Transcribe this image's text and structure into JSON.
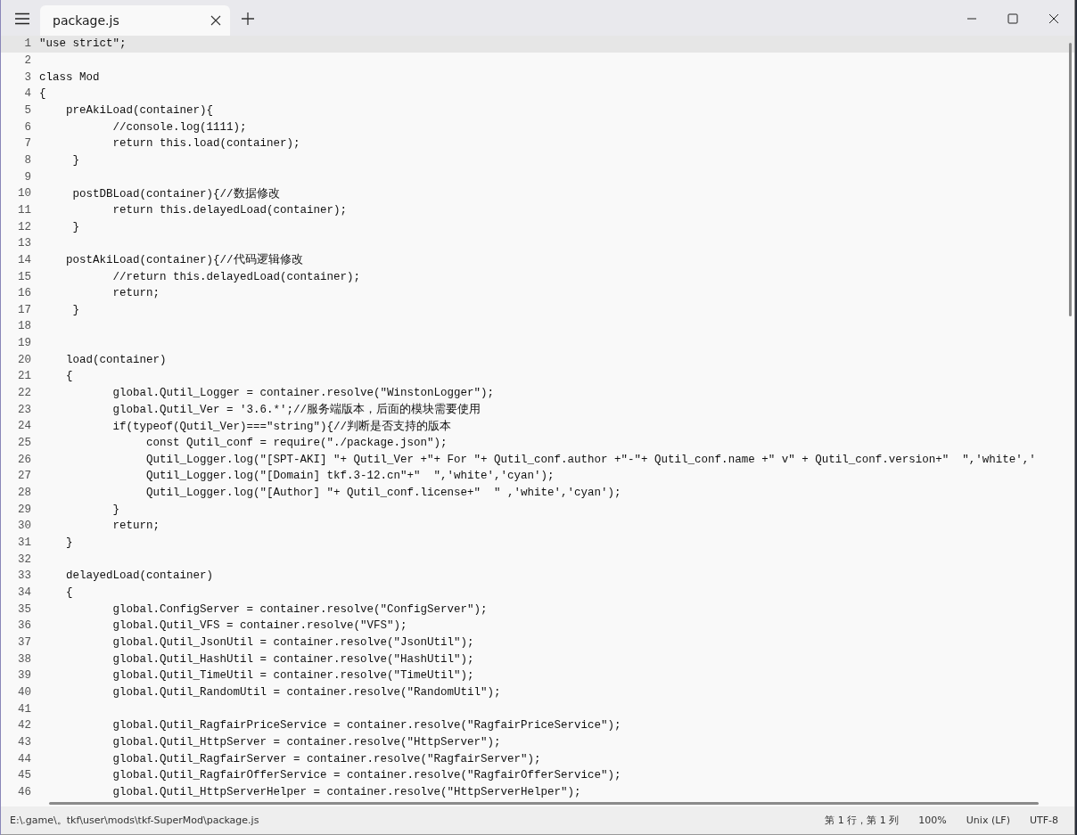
{
  "tabs": [
    {
      "title": "package.js",
      "selected": true
    }
  ],
  "lines": [
    {
      "number": "1",
      "text": "\"use strict\";",
      "current": true
    },
    {
      "number": "2",
      "current": false
    },
    {
      "number": "3",
      "text": "class Mod",
      "current": false
    },
    {
      "number": "4",
      "text": "{",
      "current": false
    },
    {
      "number": "5",
      "text": "    preAkiLoad(container){",
      "current": false
    },
    {
      "number": "6",
      "text": "           //console.log(1111);",
      "current": false
    },
    {
      "number": "7",
      "text": "           return this.load(container);",
      "current": false
    },
    {
      "number": "8",
      "text": "     }",
      "current": false
    },
    {
      "number": "9",
      "current": false
    },
    {
      "number": "10",
      "text": "     postDBLoad(container){//数据修改",
      "current": false
    },
    {
      "number": "11",
      "text": "           return this.delayedLoad(container);",
      "current": false
    },
    {
      "number": "12",
      "text": "     }",
      "current": false
    },
    {
      "number": "13",
      "current": false
    },
    {
      "number": "14",
      "text": "    postAkiLoad(container){//代码逻辑修改",
      "current": false
    },
    {
      "number": "15",
      "text": "           //return this.delayedLoad(container);",
      "current": false
    },
    {
      "number": "16",
      "text": "           return;",
      "current": false
    },
    {
      "number": "17",
      "text": "     }",
      "current": false
    },
    {
      "number": "18",
      "current": false
    },
    {
      "number": "19",
      "current": false
    },
    {
      "number": "20",
      "text": "    load(container)",
      "current": false
    },
    {
      "number": "21",
      "text": "    {",
      "current": false
    },
    {
      "number": "22",
      "text": "           global.Qutil_Logger = container.resolve(\"WinstonLogger\");",
      "current": false
    },
    {
      "number": "23",
      "text": "           global.Qutil_Ver = '3.6.*';//服务端版本，后面的模块需要使用",
      "current": false
    },
    {
      "number": "24",
      "text": "           if(typeof(Qutil_Ver)===\"string\"){//判断是否支持的版本",
      "current": false
    },
    {
      "number": "25",
      "text": "                const Qutil_conf = require(\"./package.json\");",
      "current": false
    },
    {
      "number": "26",
      "text": "                Qutil_Logger.log(\"[SPT-AKI] \"+ Qutil_Ver +\"+ For \"+ Qutil_conf.author +\"-\"+ Qutil_conf.name +\" v\" + Qutil_conf.version+\"  \",'white','",
      "current": false
    },
    {
      "number": "27",
      "text": "                Qutil_Logger.log(\"[Domain] tkf.3-12.cn\"+\"  \",'white','cyan');",
      "current": false
    },
    {
      "number": "28",
      "text": "                Qutil_Logger.log(\"[Author] \"+ Qutil_conf.license+\"  \" ,'white','cyan');",
      "current": false
    },
    {
      "number": "29",
      "text": "           }",
      "current": false
    },
    {
      "number": "30",
      "text": "           return;",
      "current": false
    },
    {
      "number": "31",
      "text": "    }",
      "current": false
    },
    {
      "number": "32",
      "current": false
    },
    {
      "number": "33",
      "text": "    delayedLoad(container)",
      "current": false
    },
    {
      "number": "34",
      "text": "    {",
      "current": false
    },
    {
      "number": "35",
      "text": "           global.ConfigServer = container.resolve(\"ConfigServer\");",
      "current": false
    },
    {
      "number": "36",
      "text": "           global.Qutil_VFS = container.resolve(\"VFS\");",
      "current": false
    },
    {
      "number": "37",
      "text": "           global.Qutil_JsonUtil = container.resolve(\"JsonUtil\");",
      "current": false
    },
    {
      "number": "38",
      "text": "           global.Qutil_HashUtil = container.resolve(\"HashUtil\");",
      "current": false
    },
    {
      "number": "39",
      "text": "           global.Qutil_TimeUtil = container.resolve(\"TimeUtil\");",
      "current": false
    },
    {
      "number": "40",
      "text": "           global.Qutil_RandomUtil = container.resolve(\"RandomUtil\");",
      "current": false
    },
    {
      "number": "41",
      "current": false
    },
    {
      "number": "42",
      "text": "           global.Qutil_RagfairPriceService = container.resolve(\"RagfairPriceService\");",
      "current": false
    },
    {
      "number": "43",
      "text": "           global.Qutil_HttpServer = container.resolve(\"HttpServer\");",
      "current": false
    },
    {
      "number": "44",
      "text": "           global.Qutil_RagfairServer = container.resolve(\"RagfairServer\");",
      "current": false
    },
    {
      "number": "45",
      "text": "           global.Qutil_RagfairOfferService = container.resolve(\"RagfairOfferService\");",
      "current": false
    },
    {
      "number": "46",
      "text": "           global.Qutil_HttpServerHelper = container.resolve(\"HttpServerHelper\");",
      "current": false
    }
  ],
  "status_bar": {
    "path": "E:\\.game\\。tkf\\user\\mods\\tkf-SuperMod\\package.js",
    "position": "第 1 行，第 1 列",
    "zoom": "100%",
    "line_ending": "Unix (LF)",
    "encoding": "UTF-8"
  }
}
